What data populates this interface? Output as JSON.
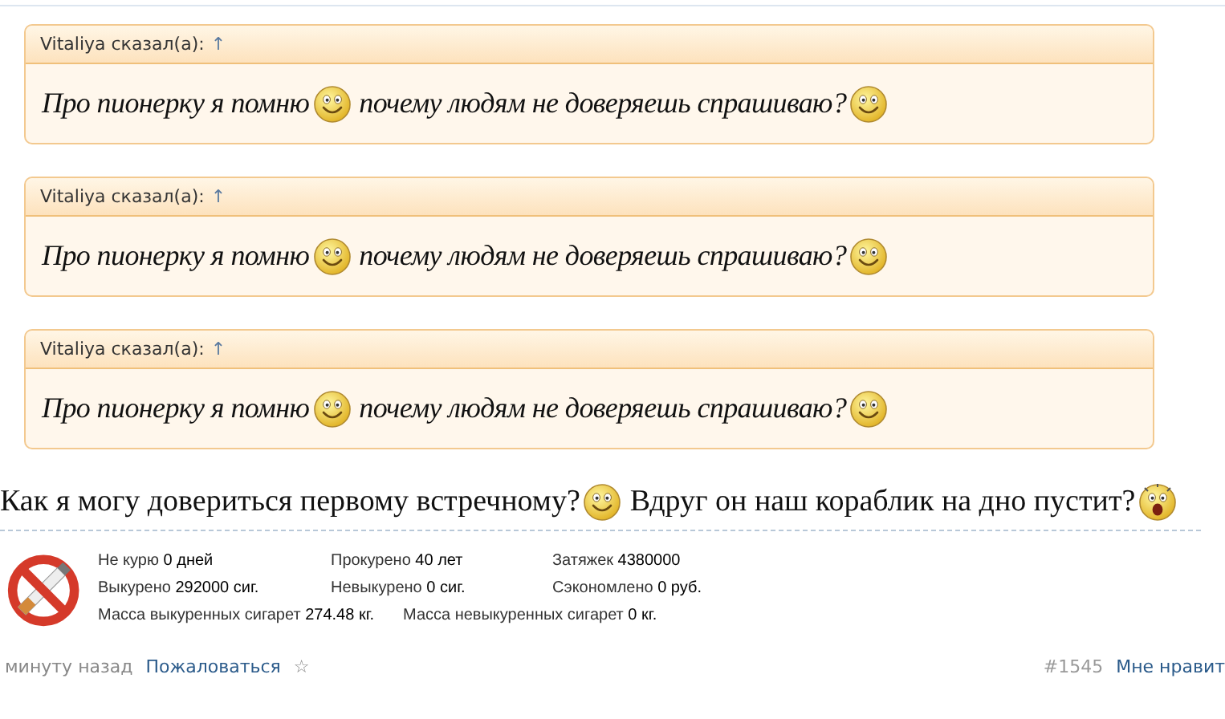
{
  "quotes": [
    {
      "author": "Vitaliya сказал(а):",
      "link": "↑",
      "body": [
        {
          "kind": "text",
          "text": "Про пионерку я помню"
        },
        {
          "kind": "smile"
        },
        {
          "kind": "text",
          "text": "почему людям не доверяешь спрашиваю?"
        },
        {
          "kind": "smile"
        }
      ]
    },
    {
      "author": "Vitaliya сказал(а):",
      "link": "↑",
      "body": [
        {
          "kind": "text",
          "text": "Про пионерку я помню"
        },
        {
          "kind": "smile"
        },
        {
          "kind": "text",
          "text": "почему людям не доверяешь спрашиваю?"
        },
        {
          "kind": "smile"
        }
      ]
    },
    {
      "author": "Vitaliya сказал(а):",
      "link": "↑",
      "body": [
        {
          "kind": "text",
          "text": "Про пионерку я помню"
        },
        {
          "kind": "smile"
        },
        {
          "kind": "text",
          "text": "почему людям не доверяешь спрашиваю?"
        },
        {
          "kind": "smile"
        }
      ]
    }
  ],
  "message": [
    {
      "kind": "text",
      "text": "Как я могу довериться первому встречному?"
    },
    {
      "kind": "smile"
    },
    {
      "kind": "text",
      "text": "Вдруг он наш кораблик на дно пустит?"
    },
    {
      "kind": "scared"
    }
  ],
  "signature": {
    "rows": [
      [
        {
          "label": "Не курю",
          "value": "0 дней"
        },
        {
          "label": "Прокурено",
          "value": "40 лет"
        },
        {
          "label": "Затяжек",
          "value": "4380000"
        }
      ],
      [
        {
          "label": "Выкурено",
          "value": "292000 сиг."
        },
        {
          "label": "Невыкурено",
          "value": "0 сиг."
        },
        {
          "label": "Сэкономлено",
          "value": "0 руб."
        }
      ],
      [
        {
          "label": "Масса выкуренных сигарет",
          "value": "274.48 кг."
        },
        {
          "label": "Масса невыкуренных сигарет",
          "value": "0 кг."
        }
      ]
    ]
  },
  "footer": {
    "time": "минуту назад",
    "report": "Пожаловаться",
    "star": "☆",
    "number": "#1545",
    "like": "Мне нравит"
  }
}
